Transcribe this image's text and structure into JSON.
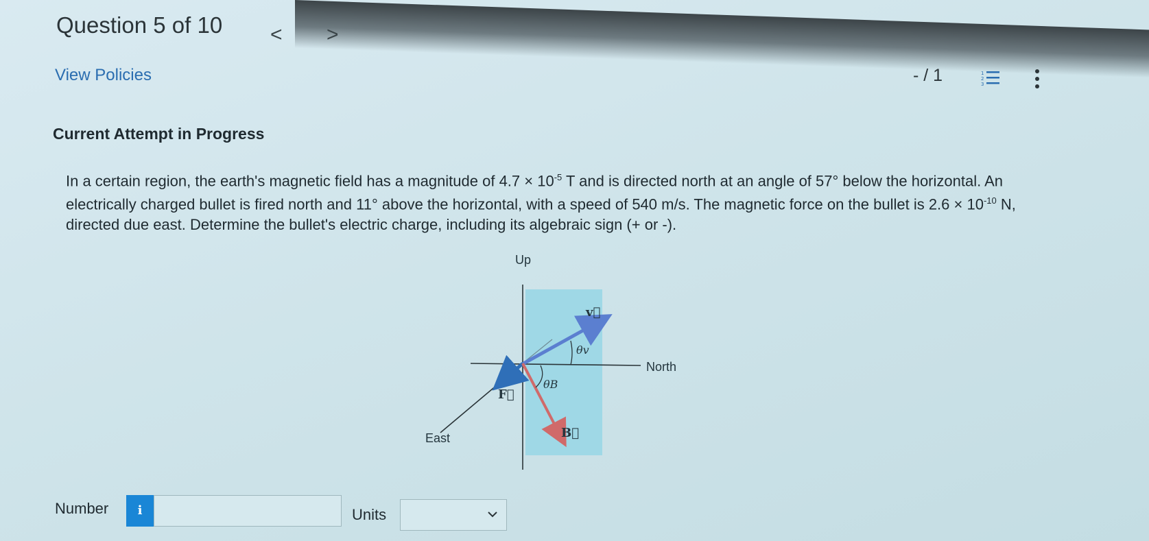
{
  "header": {
    "title": "Question 5 of 10",
    "prev_glyph": "<",
    "next_glyph": ">",
    "view_policies": "View Policies",
    "score": "- / 1",
    "list_icon": "list-icon",
    "more_icon": "more-vertical-icon"
  },
  "attempt_status": "Current Attempt in Progress",
  "question": {
    "t1": "In a certain region, the earth's magnetic field has a magnitude of 4.7 × 10",
    "e1": "-5",
    "t2": " T and is directed north at an angle of 57° below the horizontal. An electrically charged bullet is fired north and 11° above the horizontal, with a speed of 540 m/s. The magnetic force on the bullet is 2.6 × 10",
    "e2": "-10",
    "t3": " N, directed due east. Determine the bullet's electric charge, including its algebraic sign (+ or -)."
  },
  "figure": {
    "up": "Up",
    "north": "North",
    "east": "East",
    "v": "v⃗",
    "f": "F⃗",
    "b": "B⃗",
    "theta_v": "θv",
    "theta_b": "θB",
    "colors": {
      "panel": "#9fd8e6",
      "velocity": "#5b7fd0",
      "force": "#2f6fb8",
      "field": "#d06a6a"
    }
  },
  "answer": {
    "number_label": "Number",
    "info_glyph": "i",
    "number_value": "",
    "units_label": "Units",
    "units_value": ""
  }
}
